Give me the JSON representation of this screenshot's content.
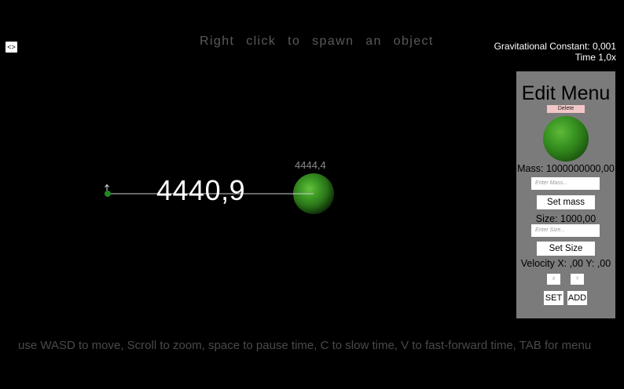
{
  "toggle_button": {
    "label": "<>"
  },
  "top_hint": "Right click to spawn an object",
  "hud": {
    "gravitational_constant": "Gravitational Constant: 0,001",
    "time": "Time  1,0x"
  },
  "scene": {
    "distance_label": "4440,9",
    "planet_label": "4444,4",
    "colors": {
      "planet": "#3d9a24",
      "small_object": "#1f8a1f",
      "line": "#cfcfcf"
    }
  },
  "bottom_hint": "use WASD to move, Scroll to zoom, space to pause time, C to slow time, V to fast-forward time, TAB for menu",
  "edit_menu": {
    "title": "Edit Menu",
    "delete_label": "Delete",
    "mass_text": "Mass: 1000000000,00",
    "mass_placeholder": "Enter Mass...",
    "set_mass_label": "Set mass",
    "size_text": "Size: 1000,00",
    "size_placeholder": "Enter Size...",
    "set_size_label": "Set Size",
    "velocity_text": "Velocity X: ,00 Y: ,00",
    "x_placeholder": "X",
    "y_placeholder": "Y",
    "set_label": "SET",
    "add_label": "ADD"
  }
}
